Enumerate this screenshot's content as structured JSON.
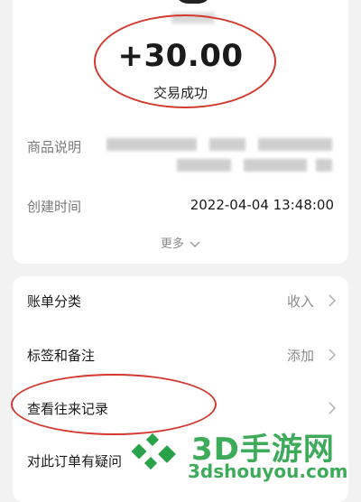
{
  "transaction": {
    "amount": "+30.00",
    "status": "交易成功"
  },
  "details": {
    "product_label": "商品说明",
    "created_label": "创建时间",
    "created_value": "2022-04-04 13:48:00",
    "more_label": "更多"
  },
  "list": {
    "items": [
      {
        "label": "账单分类",
        "value": "收入"
      },
      {
        "label": "标签和备注",
        "value": "添加"
      },
      {
        "label": "查看往来记录",
        "value": ""
      },
      {
        "label": "对此订单有疑问",
        "value": ""
      }
    ]
  },
  "watermark": {
    "title": "3D手游网",
    "site": "3dshouyou.com"
  },
  "colors": {
    "annotation_red": "#d33a2f",
    "watermark_green": "#2aa24a"
  },
  "icons": {
    "more": "chevron-down-icon",
    "row": "chevron-right-icon"
  }
}
